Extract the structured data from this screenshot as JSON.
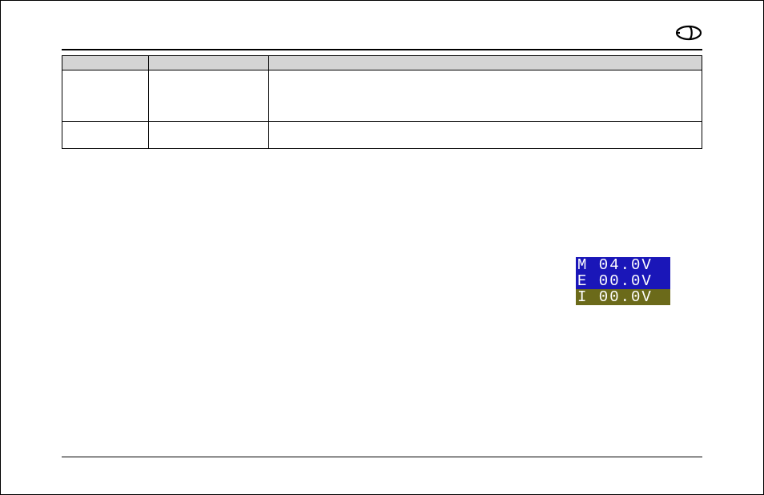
{
  "logo": {
    "name": "brand-logo"
  },
  "table": {
    "headers": [
      "",
      "",
      ""
    ],
    "rows": [
      {
        "c1": "",
        "c2": "",
        "c3": ""
      },
      {
        "c1": "",
        "c2": "",
        "c3": ""
      }
    ]
  },
  "lcd": {
    "line1": "M 04.0V",
    "line2": "E 00.0V",
    "line3": "I 00.0V"
  }
}
